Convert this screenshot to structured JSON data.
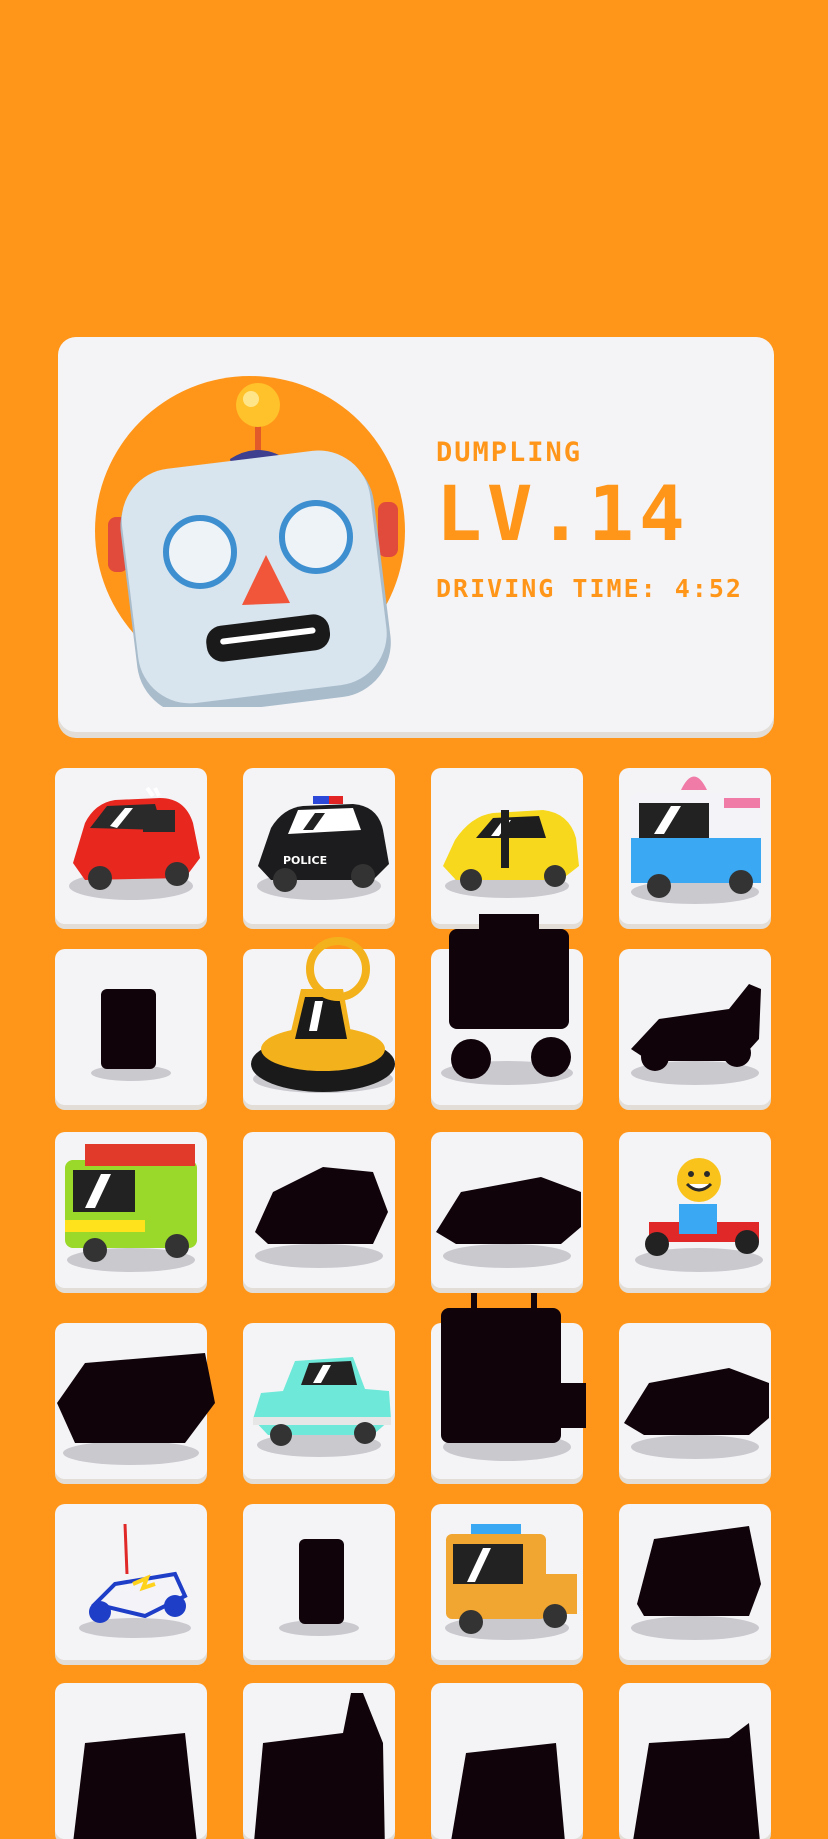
{
  "profile": {
    "name": "DUMPLING",
    "level": "LV.14",
    "driving_time": "DRIVING TIME: 4:52",
    "avatar_icon": "robot-face-icon"
  },
  "colors": {
    "background": "#FF961A",
    "card": "#F4F4F7",
    "text_accent": "#FF961A",
    "silhouette": "#10040A"
  },
  "vehicles": [
    {
      "name": "red-hatchback",
      "icon": "red-car-icon",
      "unlocked": true
    },
    {
      "name": "police-car",
      "icon": "police-car-icon",
      "unlocked": true
    },
    {
      "name": "yellow-sports-car",
      "icon": "yellow-sports-car-icon",
      "unlocked": true
    },
    {
      "name": "ice-cream-truck",
      "icon": "ice-cream-truck-icon",
      "unlocked": true
    },
    {
      "name": "locked-1",
      "icon": "locked-vehicle-silhouette-icon",
      "unlocked": false
    },
    {
      "name": "hovercraft",
      "icon": "hovercraft-icon",
      "unlocked": true
    },
    {
      "name": "locked-2",
      "icon": "locked-vehicle-silhouette-icon",
      "unlocked": false
    },
    {
      "name": "locked-3",
      "icon": "locked-vehicle-silhouette-icon",
      "unlocked": false
    },
    {
      "name": "safari-van",
      "icon": "safari-van-icon",
      "unlocked": true
    },
    {
      "name": "locked-4",
      "icon": "locked-vehicle-silhouette-icon",
      "unlocked": false
    },
    {
      "name": "locked-5",
      "icon": "locked-vehicle-silhouette-icon",
      "unlocked": false
    },
    {
      "name": "go-kart",
      "icon": "go-kart-icon",
      "unlocked": true
    },
    {
      "name": "locked-6",
      "icon": "locked-vehicle-silhouette-icon",
      "unlocked": false
    },
    {
      "name": "retro-teal-car",
      "icon": "retro-teal-car-icon",
      "unlocked": true
    },
    {
      "name": "locked-7",
      "icon": "locked-vehicle-silhouette-icon",
      "unlocked": false
    },
    {
      "name": "locked-8",
      "icon": "locked-vehicle-silhouette-icon",
      "unlocked": false
    },
    {
      "name": "rc-buggy",
      "icon": "rc-buggy-icon",
      "unlocked": true
    },
    {
      "name": "locked-9",
      "icon": "locked-vehicle-silhouette-icon",
      "unlocked": false
    },
    {
      "name": "tow-truck",
      "icon": "tow-truck-icon",
      "unlocked": true
    },
    {
      "name": "locked-10",
      "icon": "locked-vehicle-silhouette-icon",
      "unlocked": false
    },
    {
      "name": "locked-11",
      "icon": "locked-vehicle-silhouette-icon",
      "unlocked": false
    },
    {
      "name": "locked-12",
      "icon": "locked-vehicle-silhouette-icon",
      "unlocked": false
    },
    {
      "name": "locked-13",
      "icon": "locked-vehicle-silhouette-icon",
      "unlocked": false
    },
    {
      "name": "locked-14",
      "icon": "locked-vehicle-silhouette-icon",
      "unlocked": false
    }
  ]
}
